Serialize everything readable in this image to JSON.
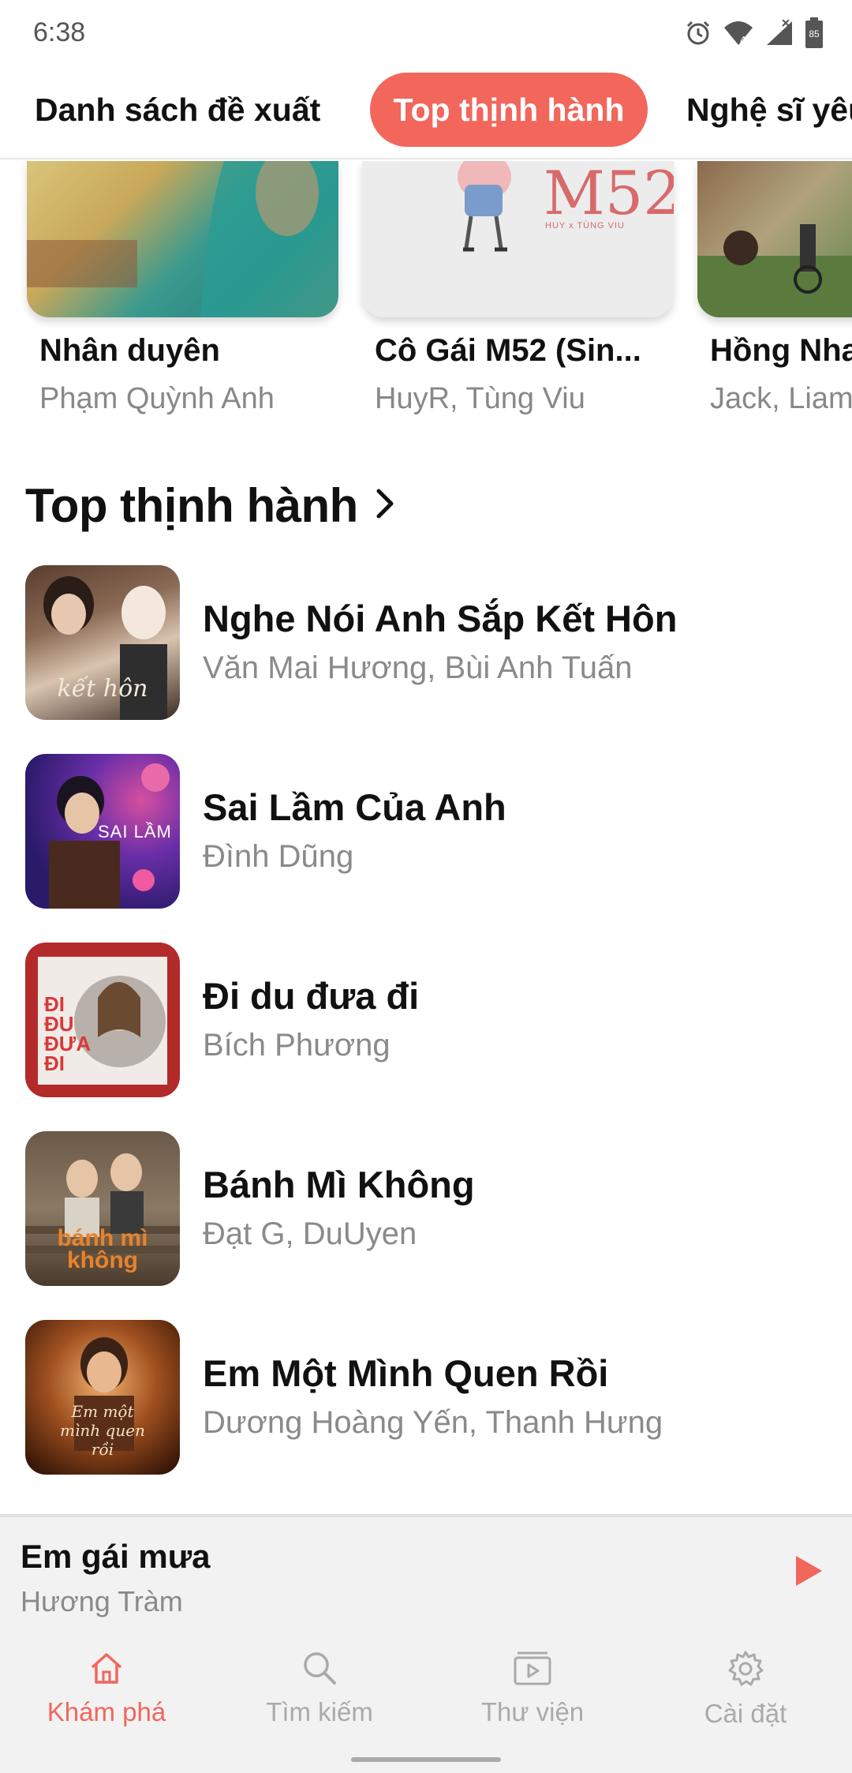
{
  "status_bar": {
    "time": "6:38",
    "icons": [
      "alarm-icon",
      "wifi-icon",
      "signal-icon",
      "battery-icon"
    ],
    "battery_level": "85"
  },
  "tabs": [
    {
      "label": "Danh sách đề xuất",
      "active": false
    },
    {
      "label": "Top thịnh hành",
      "active": true
    },
    {
      "label": "Nghệ sĩ yêu",
      "active": false
    }
  ],
  "featured": [
    {
      "title": "Nhân duyên",
      "artist": "Phạm Quỳnh Anh"
    },
    {
      "title": "Cô Gái M52 (Sin...",
      "artist": "HuyR, Tùng Viu",
      "art_text": "M52",
      "art_caption": "HUY x TÙNG VIU"
    },
    {
      "title": "Hồng Nha",
      "artist": "Jack, Liam"
    }
  ],
  "section": {
    "title": "Top thịnh hành",
    "icon": "chevron-right-icon"
  },
  "songs": [
    {
      "title": "Nghe Nói Anh Sắp Kết Hôn",
      "artist": "Văn Mai Hương, Bùi Anh Tuấn",
      "art_text": "kết hôn"
    },
    {
      "title": "Sai Lầm Của Anh",
      "artist": "Đình Dũng",
      "art_text": "SAI LẦM"
    },
    {
      "title": "Đi du đưa đi",
      "artist": "Bích Phương",
      "art_text": "ĐI ĐU ĐƯA ĐI"
    },
    {
      "title": "Bánh Mì Không",
      "artist": "Đạt G, DuUyen",
      "art_text": "bánh mì không"
    },
    {
      "title": "Em Một Mình Quen Rồi",
      "artist": "Dương Hoàng Yến, Thanh Hưng",
      "art_text": "Em một mình quen rồi"
    }
  ],
  "mini_player": {
    "title": "Em gái mưa",
    "artist": "Hương Tràm",
    "icon": "play-icon"
  },
  "bottom_nav": [
    {
      "label": "Khám phá",
      "icon": "home-icon",
      "active": true
    },
    {
      "label": "Tìm kiếm",
      "icon": "search-icon",
      "active": false
    },
    {
      "label": "Thư viện",
      "icon": "library-icon",
      "active": false
    },
    {
      "label": "Cài đặt",
      "icon": "gear-icon",
      "active": false
    }
  ],
  "colors": {
    "accent": "#f2665c",
    "secondary_text": "#8a8a8a",
    "nav_inactive": "#aaaaaa",
    "player_bg": "#f2f2f2"
  }
}
